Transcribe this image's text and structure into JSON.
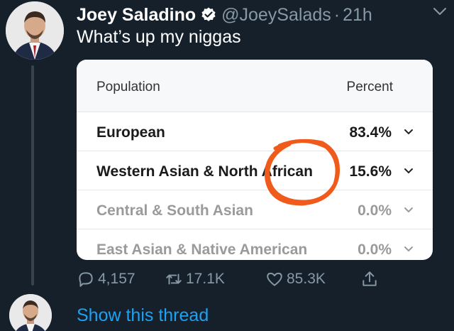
{
  "tweet": {
    "author_name": "Joey Saladino",
    "handle": "@JoeySalads",
    "separator": "·",
    "time": "21h",
    "text": "What’s up my niggas"
  },
  "card": {
    "header_population": "Population",
    "header_percent": "Percent",
    "rows": [
      {
        "label": "European",
        "value": "83.4%"
      },
      {
        "label": "Western Asian & North African",
        "value": "15.6%"
      },
      {
        "label": "Central & South Asian",
        "value": "0.0%"
      },
      {
        "label": "East Asian & Native American",
        "value": "0.0%"
      }
    ],
    "annotation_color": "#f05a1a"
  },
  "actions": {
    "replies": "4,157",
    "retweets": "17.1K",
    "likes": "85.3K"
  },
  "thread_link": "Show this thread",
  "colors": {
    "background": "#15202b",
    "secondary_text": "#8899a6",
    "link": "#1da1f2",
    "verified": "#ffffff"
  },
  "icons": [
    "verified-badge-icon",
    "chevron-down-icon",
    "reply-icon",
    "retweet-icon",
    "like-icon",
    "share-icon"
  ]
}
